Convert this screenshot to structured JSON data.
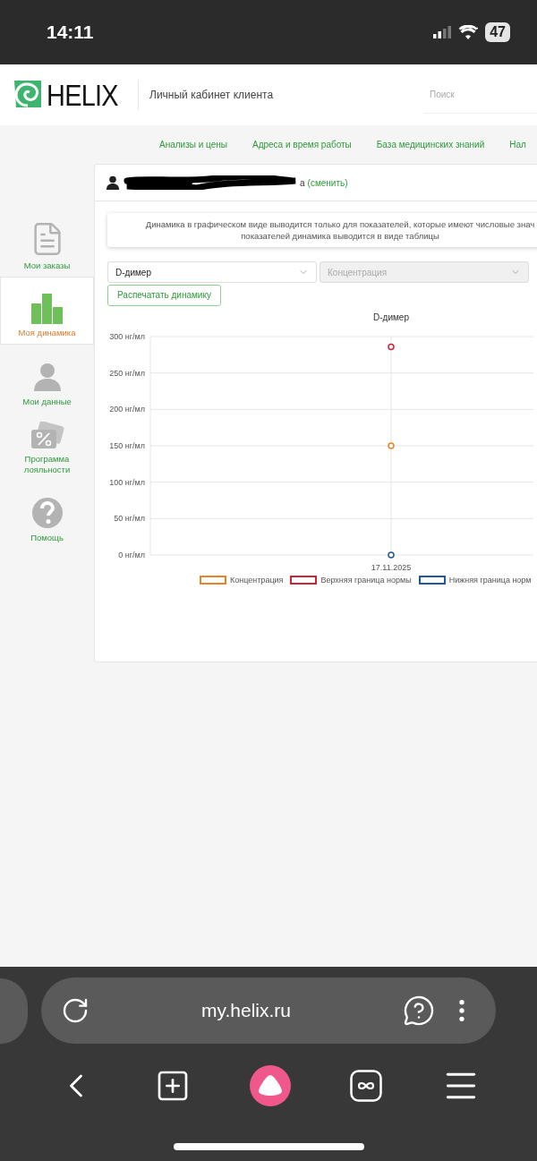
{
  "status_bar": {
    "time": "14:11",
    "battery": "47"
  },
  "header": {
    "logo": "HELIX",
    "subtitle": "Личный кабинет клиента",
    "search": {
      "placeholder": "Поиск"
    }
  },
  "nav": [
    {
      "label": "Анализы и цены"
    },
    {
      "label": "Адреса и время работы"
    },
    {
      "label": "База медицинских знаний"
    },
    {
      "label": "Нал"
    }
  ],
  "sidebar": {
    "items": [
      {
        "kind": "document",
        "label": "Мои заказы",
        "selected": false
      },
      {
        "kind": "bars",
        "label": "Моя динамика",
        "selected": true
      },
      {
        "kind": "person",
        "label": "Мои данные",
        "selected": false
      },
      {
        "kind": "discount",
        "label": "Программа лояльности",
        "selected": false
      },
      {
        "kind": "help",
        "label": "Помощь",
        "selected": false
      }
    ]
  },
  "user": {
    "name_tail": "а",
    "change_link": "(сменить)"
  },
  "notice": {
    "line_1": "Динамика в графическом виде выводится только для показателей, которые имеют числовые знач",
    "line_2": "показателей динамика выводится в виде таблицы"
  },
  "selects": [
    {
      "value": "D-димер",
      "disabled": false
    },
    {
      "value": "Концентрация",
      "disabled": true
    }
  ],
  "print_button": "Распечатать динамику",
  "chart": {
    "chart_data": {
      "type": "scatter",
      "title": "D-димер",
      "grid": true,
      "legend": "bottom",
      "categories": [
        "17.11.2025"
      ],
      "ylim": [
        0,
        300
      ],
      "yticks": [
        {
          "value": 0,
          "label": "0 нг/мл"
        },
        {
          "value": 50,
          "label": "50 нг/мл"
        },
        {
          "value": 100,
          "label": "100 нг/мл"
        },
        {
          "value": 150,
          "label": "150 нг/мл"
        },
        {
          "value": 200,
          "label": "200 нг/мл"
        },
        {
          "value": 250,
          "label": "250 нг/мл"
        },
        {
          "value": 300,
          "label": "300 нг/мл"
        }
      ],
      "series": [
        {
          "name": "Концентрация",
          "color": "#e8832a",
          "values": [
            150
          ]
        },
        {
          "name": "Верхняя граница нормы",
          "color": "#c8243a",
          "values": [
            286
          ]
        },
        {
          "name": "Нижняя граница норм",
          "color": "#1f5a9a",
          "values": [
            0
          ]
        }
      ]
    }
  },
  "browser": {
    "url": "my.helix.ru"
  }
}
